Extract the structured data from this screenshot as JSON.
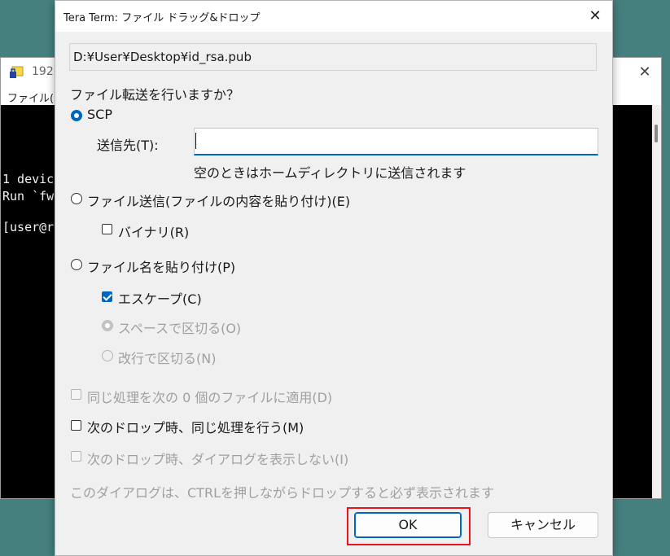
{
  "background_window": {
    "title": "192.",
    "menu_label": "ファイル(F)",
    "close_glyph": "✕",
    "terminal_lines": [
      "1 devic",
      "Run `fw",
      "",
      "[user@r"
    ]
  },
  "dialog": {
    "title": "Tera Term: ファイル ドラッグ&ドロップ",
    "close_glyph": "✕",
    "file_path": "D:¥User¥Desktop¥id_rsa.pub",
    "question": "ファイル転送を行いますか？",
    "options": {
      "scp": {
        "label": "SCP",
        "selected": true
      },
      "destination_label": "送信先(T):",
      "destination_value": "",
      "destination_hint": "空のときはホームディレクトリに送信されます",
      "send_file": {
        "label": "ファイル送信(ファイルの内容を貼り付け)(E)",
        "selected": false
      },
      "binary": {
        "label": "バイナリ(R)",
        "checked": false
      },
      "paste_filename": {
        "label": "ファイル名を貼り付け(P)",
        "selected": false
      },
      "escape": {
        "label": "エスケープ(C)",
        "checked": true
      },
      "space_separate": {
        "label": "スペースで区切る(O)",
        "selected": true,
        "disabled": true
      },
      "newline_separate": {
        "label": "改行で区切る(N)",
        "selected": false,
        "disabled": true
      }
    },
    "apply_next": {
      "label": "同じ処理を次の 0 個のファイルに適用(D)",
      "checked": false,
      "disabled": true
    },
    "same_next_drop": {
      "label": "次のドロップ時、同じ処理を行う(M)",
      "checked": false
    },
    "no_dialog_next": {
      "label": "次のドロップ時、ダイアログを表示しない(I)",
      "checked": false,
      "disabled": true
    },
    "note": "このダイアログは、CTRLを押しながらドロップすると必ず表示されます",
    "ok_label": "OK",
    "cancel_label": "キャンセル"
  },
  "colors": {
    "desktop": "#457f7e",
    "accent": "#0067c0",
    "highlight": "#e8151c"
  }
}
